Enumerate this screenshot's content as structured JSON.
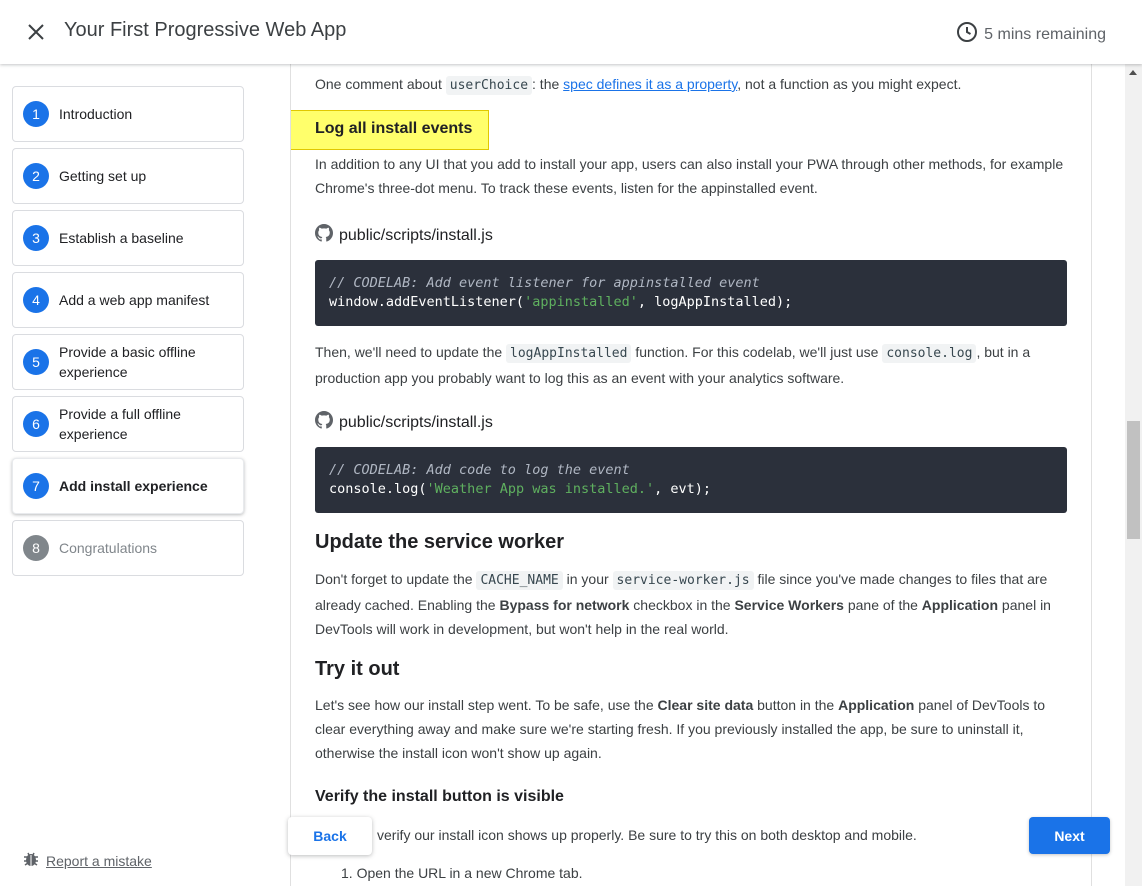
{
  "header": {
    "title": "Your First Progressive Web App",
    "time_remaining": "5 mins remaining"
  },
  "sidebar": {
    "steps": [
      {
        "num": "1",
        "label": "Introduction"
      },
      {
        "num": "2",
        "label": "Getting set up"
      },
      {
        "num": "3",
        "label": "Establish a baseline"
      },
      {
        "num": "4",
        "label": "Add a web app manifest"
      },
      {
        "num": "5",
        "label": "Provide a basic offline experience"
      },
      {
        "num": "6",
        "label": "Provide a full offline experience"
      },
      {
        "num": "7",
        "label": "Add install experience"
      },
      {
        "num": "8",
        "label": "Congratulations"
      }
    ],
    "report_label": "Report a mistake"
  },
  "content": {
    "p_userchoice_a": "One comment about ",
    "p_userchoice_code": "userChoice",
    "p_userchoice_b": ": the ",
    "p_userchoice_link": "spec defines it as a property",
    "p_userchoice_c": ", not a function as you might expect.",
    "heading_log": "Log all install events",
    "p_log": "In addition to any UI that you add to install your app, users can also install your PWA through other methods, for example Chrome's three-dot menu. To track these events, listen for the appinstalled event.",
    "file_1": "public/scripts/install.js",
    "code_1": {
      "comment": "// CODELAB: Add event listener for appinstalled event",
      "pre": "window.addEventListener(",
      "string": "'appinstalled'",
      "post": ", logAppInstalled);"
    },
    "p_then_a": "Then, we'll need to update the ",
    "p_then_code1": "logAppInstalled",
    "p_then_b": " function. For this codelab, we'll just use ",
    "p_then_code2": "console.log",
    "p_then_c": ", but in a production app you probably want to log this as an event with your analytics software.",
    "file_2": "public/scripts/install.js",
    "code_2": {
      "comment": "// CODELAB: Add code to log the event",
      "pre": "console.log(",
      "string": "'Weather App was installed.'",
      "post": ", evt);"
    },
    "heading_sw": "Update the service worker",
    "p_sw_a": "Don't forget to update the ",
    "p_sw_code1": "CACHE_NAME",
    "p_sw_b": " in your ",
    "p_sw_code2": "service-worker.js",
    "p_sw_c": " file since you've made changes to files that are already cached. Enabling the ",
    "p_sw_bold1": "Bypass for network",
    "p_sw_d": " checkbox in the ",
    "p_sw_bold2": "Service Workers",
    "p_sw_e": " pane of the ",
    "p_sw_bold3": "Application",
    "p_sw_f": " panel in DevTools will work in development, but won't help in the real world.",
    "heading_try": "Try it out",
    "p_try_a": "Let's see how our install step went. To be safe, use the ",
    "p_try_bold1": "Clear site data",
    "p_try_b": " button in the ",
    "p_try_bold2": "Application",
    "p_try_c": " panel of DevTools to clear everything away and make sure we're starting fresh. If you previously installed the app, be sure to uninstall it, otherwise the install icon won't show up again.",
    "heading_verify": "Verify the install button is visible",
    "p_verify": "verify our install icon shows up properly. Be sure to try this on both desktop and mobile.",
    "list_item_1": "Open the URL in a new Chrome tab."
  },
  "nav": {
    "back": "Back",
    "next": "Next"
  },
  "colors": {
    "accent": "#1a73e8",
    "highlight": "#ffff6b",
    "code_bg": "#2b303b"
  }
}
